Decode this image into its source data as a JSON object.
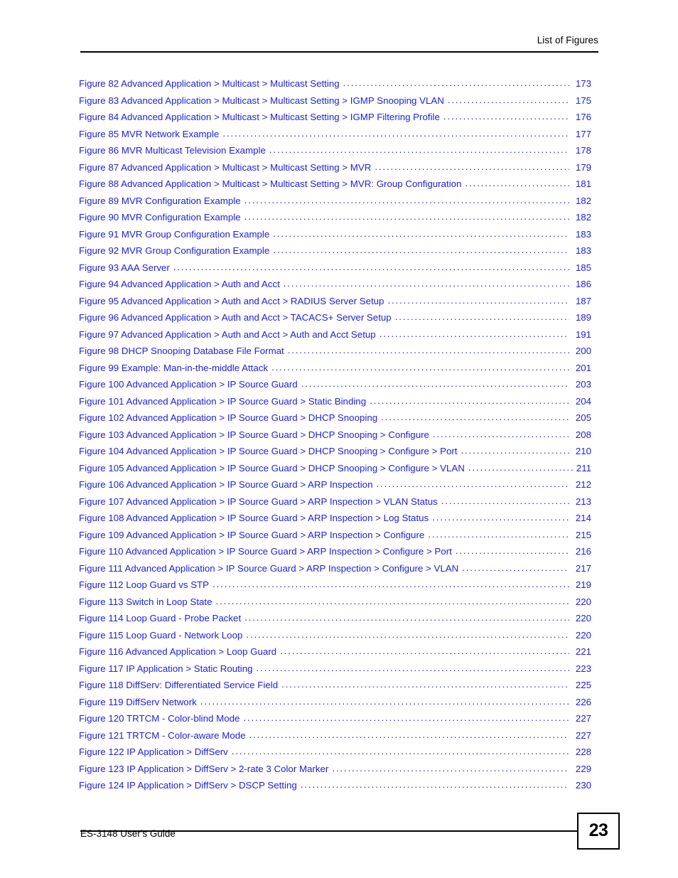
{
  "header": {
    "title": "List of Figures"
  },
  "footer": {
    "guide_label": "ES-3148 User's Guide",
    "page_number": "23"
  },
  "toc": {
    "leader_dots": "..................................................................................................................................................",
    "entries": [
      {
        "label": "Figure 82 Advanced Application > Multicast > Multicast Setting",
        "page": "173",
        "tight": false
      },
      {
        "label": "Figure 83 Advanced Application > Multicast > Multicast Setting > IGMP Snooping VLAN",
        "page": "175",
        "tight": false
      },
      {
        "label": "Figure 84 Advanced Application > Multicast > Multicast Setting > IGMP Filtering Profile",
        "page": "176",
        "tight": false
      },
      {
        "label": "Figure 85 MVR Network Example",
        "page": "177",
        "tight": false
      },
      {
        "label": "Figure 86 MVR Multicast Television Example",
        "page": "178",
        "tight": false
      },
      {
        "label": "Figure 87 Advanced Application > Multicast > Multicast Setting > MVR",
        "page": "179",
        "tight": false
      },
      {
        "label": "Figure 88 Advanced Application > Multicast > Multicast Setting > MVR: Group Configuration",
        "page": "181",
        "tight": false
      },
      {
        "label": "Figure 89 MVR Configuration Example",
        "page": "182",
        "tight": false
      },
      {
        "label": "Figure 90 MVR Configuration Example",
        "page": "182",
        "tight": false
      },
      {
        "label": "Figure 91 MVR Group Configuration Example",
        "page": "183",
        "tight": false
      },
      {
        "label": "Figure 92 MVR Group Configuration Example",
        "page": "183",
        "tight": false
      },
      {
        "label": "Figure 93 AAA Server",
        "page": "185",
        "tight": false
      },
      {
        "label": "Figure 94 Advanced Application > Auth and Acct",
        "page": "186",
        "tight": false
      },
      {
        "label": "Figure 95 Advanced Application > Auth and Acct > RADIUS Server Setup",
        "page": "187",
        "tight": false
      },
      {
        "label": "Figure 96 Advanced Application > Auth and Acct > TACACS+ Server Setup",
        "page": "189",
        "tight": false
      },
      {
        "label": "Figure 97 Advanced Application > Auth and Acct > Auth and Acct Setup",
        "page": "191",
        "tight": false
      },
      {
        "label": "Figure 98 DHCP Snooping Database File Format",
        "page": "200",
        "tight": false
      },
      {
        "label": "Figure 99 Example: Man-in-the-middle Attack",
        "page": "201",
        "tight": false
      },
      {
        "label": "Figure 100 Advanced Application > IP Source Guard",
        "page": "203",
        "tight": false
      },
      {
        "label": "Figure 101 Advanced Application > IP Source Guard > Static Binding",
        "page": "204",
        "tight": false
      },
      {
        "label": "Figure 102 Advanced Application > IP Source Guard > DHCP Snooping",
        "page": "205",
        "tight": false
      },
      {
        "label": "Figure 103 Advanced Application > IP Source Guard > DHCP Snooping > Configure",
        "page": "208",
        "tight": false
      },
      {
        "label": "Figure 104 Advanced Application > IP Source Guard > DHCP Snooping > Configure > Port",
        "page": "210",
        "tight": false
      },
      {
        "label": "Figure 105 Advanced Application > IP Source Guard > DHCP Snooping > Configure > VLAN",
        "page": "211",
        "tight": true
      },
      {
        "label": "Figure 106 Advanced Application > IP Source Guard > ARP Inspection",
        "page": "212",
        "tight": false
      },
      {
        "label": "Figure 107 Advanced Application > IP Source Guard > ARP Inspection > VLAN Status",
        "page": "213",
        "tight": false
      },
      {
        "label": "Figure 108 Advanced Application > IP Source Guard > ARP Inspection > Log Status",
        "page": "214",
        "tight": false
      },
      {
        "label": "Figure 109 Advanced Application > IP Source Guard > ARP Inspection > Configure",
        "page": "215",
        "tight": false
      },
      {
        "label": "Figure 110 Advanced Application > IP Source Guard > ARP Inspection > Configure > Port",
        "page": "216",
        "tight": false
      },
      {
        "label": "Figure 111 Advanced Application > IP Source Guard > ARP Inspection > Configure > VLAN",
        "page": "217",
        "tight": false
      },
      {
        "label": "Figure 112 Loop Guard vs STP",
        "page": "219",
        "tight": false
      },
      {
        "label": "Figure 113 Switch in Loop State",
        "page": "220",
        "tight": false
      },
      {
        "label": "Figure 114 Loop Guard - Probe Packet",
        "page": "220",
        "tight": false
      },
      {
        "label": "Figure 115 Loop Guard - Network Loop",
        "page": "220",
        "tight": false
      },
      {
        "label": "Figure 116 Advanced Application > Loop Guard",
        "page": "221",
        "tight": false
      },
      {
        "label": "Figure 117 IP Application > Static Routing",
        "page": "223",
        "tight": false
      },
      {
        "label": "Figure 118 DiffServ: Differentiated Service Field",
        "page": "225",
        "tight": false
      },
      {
        "label": "Figure 119 DiffServ Network",
        "page": "226",
        "tight": false
      },
      {
        "label": "Figure 120 TRTCM - Color-blind Mode",
        "page": "227",
        "tight": false
      },
      {
        "label": "Figure 121 TRTCM - Color-aware Mode",
        "page": "227",
        "tight": false
      },
      {
        "label": "Figure 122 IP Application > DiffServ",
        "page": "228",
        "tight": false
      },
      {
        "label": "Figure 123 IP Application > DiffServ > 2-rate 3 Color Marker",
        "page": "229",
        "tight": false
      },
      {
        "label": "Figure 124 IP Application > DiffServ > DSCP Setting",
        "page": "230",
        "tight": false
      }
    ]
  }
}
